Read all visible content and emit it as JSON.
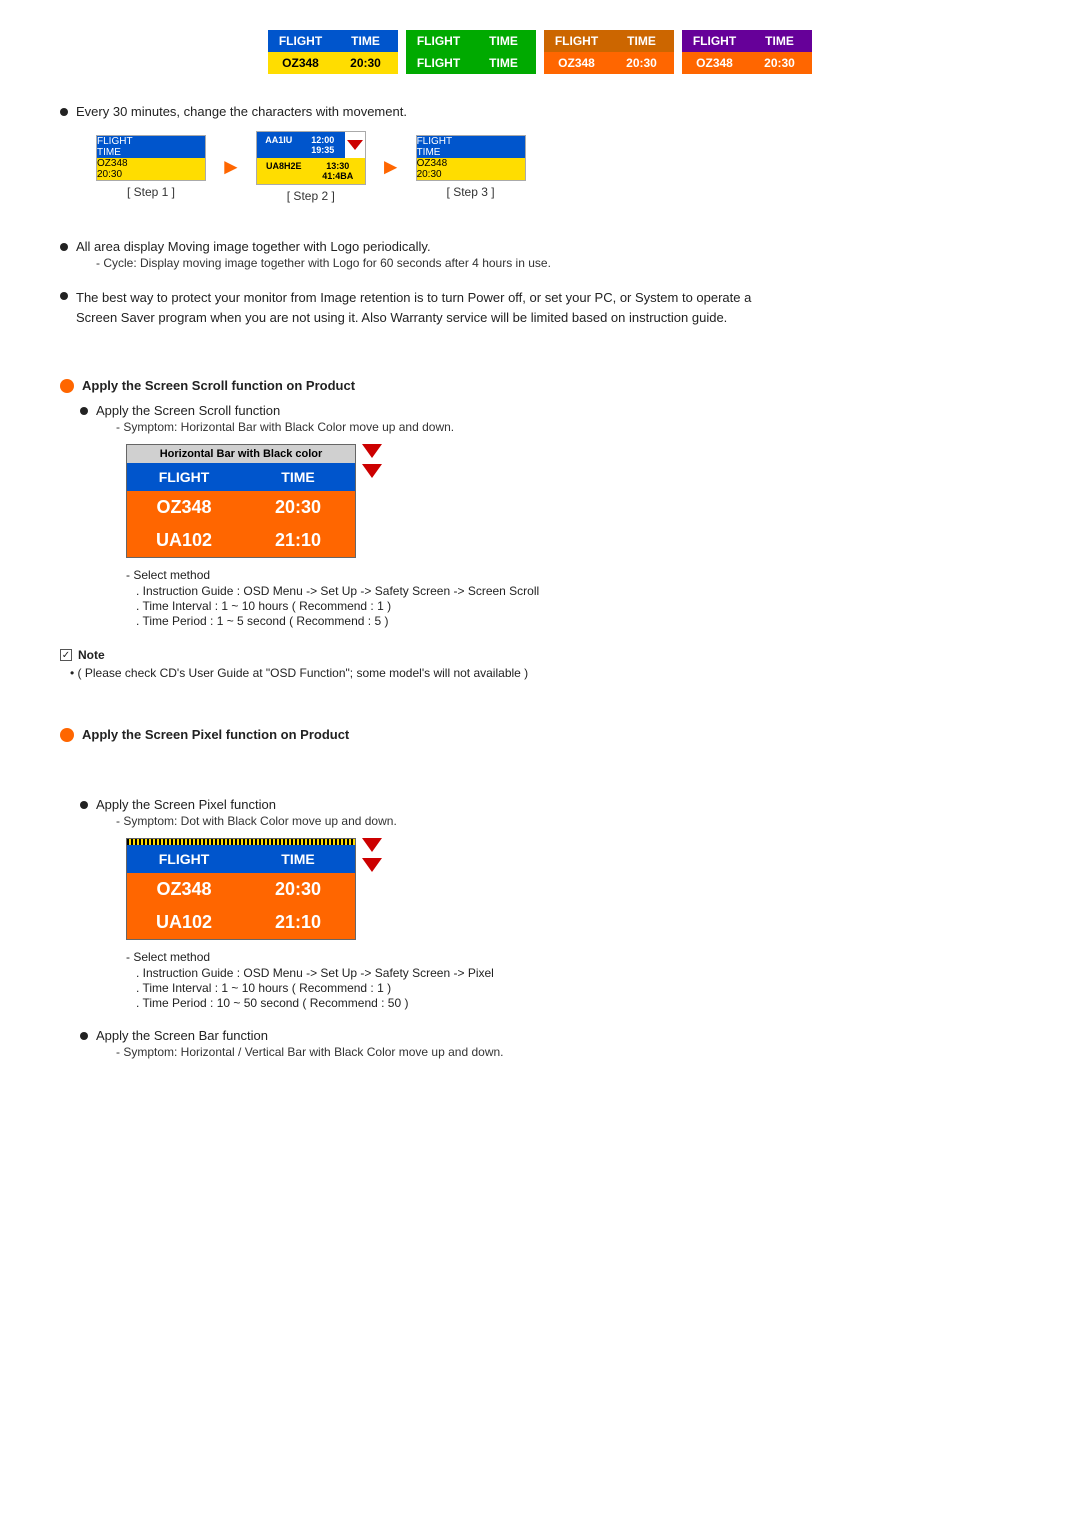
{
  "panels_row1": [
    {
      "top_left": "FLIGHT",
      "top_right": "TIME",
      "bottom_left": "OZ348",
      "bottom_right": "20:30",
      "top_bg": "blue",
      "bottom_bg": "yellow"
    },
    {
      "top_left": "FLIGHT",
      "top_right": "TIME",
      "bottom_left": "FLIGHT",
      "bottom_right": "TIME",
      "top_bg": "green",
      "bottom_bg": "green"
    },
    {
      "top_left": "FLIGHT",
      "top_right": "TIME",
      "bottom_left": "OZ348",
      "bottom_right": "20:30",
      "top_bg": "orange",
      "bottom_bg": "orange"
    },
    {
      "top_left": "FLIGHT",
      "top_right": "TIME",
      "bottom_left": "OZ348",
      "bottom_right": "20:30",
      "top_bg": "purple",
      "bottom_bg": "orange"
    }
  ],
  "bullet1": {
    "text": "Every 30 minutes, change the characters with movement."
  },
  "steps": {
    "step1_label": "[ Step 1 ]",
    "step2_label": "[ Step 2 ]",
    "step3_label": "[ Step 3 ]"
  },
  "bullet2": {
    "text": "All area display Moving image together with Logo periodically.",
    "sub": "- Cycle: Display moving image together with Logo for 60 seconds after 4 hours in use."
  },
  "bullet3": {
    "text": "The best way to protect your monitor from Image retention is to turn Power off, or set your PC, or System to operate a Screen Saver program when you are not using it. Also Warranty service will be limited based on instruction guide."
  },
  "screen_scroll": {
    "header": "Apply the Screen Scroll function on Product",
    "sub1": "Apply the Screen Scroll function",
    "sub1_symptom": "- Symptom: Horizontal Bar with Black Color move up and down.",
    "table_header": "Horizontal Bar with Black color",
    "rows": [
      {
        "left": "FLIGHT",
        "right": "TIME",
        "left_bg": "blue",
        "right_bg": "blue"
      },
      {
        "left": "OZ348",
        "right": "20:30",
        "left_bg": "orange",
        "right_bg": "orange"
      },
      {
        "left": "UA102",
        "right": "21:10",
        "left_bg": "orange",
        "right_bg": "orange"
      }
    ],
    "select_method": "- Select method",
    "lines": [
      ". Instruction Guide : OSD Menu -> Set Up -> Safety Screen -> Screen Scroll",
      ". Time Interval : 1 ~ 10 hours ( Recommend : 1 )",
      ". Time Period : 1 ~ 5 second ( Recommend : 5 )"
    ]
  },
  "note": {
    "header": "Note",
    "bullet": "( Please check CD's User Guide at \"OSD Function\"; some model's will not available )"
  },
  "screen_pixel": {
    "header": "Apply the Screen Pixel function on Product",
    "sub1": "Apply the Screen Pixel function",
    "sub1_symptom": "- Symptom: Dot with Black Color move up and down.",
    "rows": [
      {
        "left": "FLIGHT",
        "right": "TIME",
        "left_bg": "blue",
        "right_bg": "blue"
      },
      {
        "left": "OZ348",
        "right": "20:30",
        "left_bg": "orange",
        "right_bg": "orange"
      },
      {
        "left": "UA102",
        "right": "21:10",
        "left_bg": "orange",
        "right_bg": "orange"
      }
    ],
    "select_method": "- Select method",
    "lines": [
      ". Instruction Guide : OSD Menu -> Set Up -> Safety Screen -> Pixel",
      ". Time Interval : 1 ~ 10 hours ( Recommend : 1 )",
      ". Time Period : 10 ~ 50 second ( Recommend : 50 )"
    ],
    "sub2": "Apply the Screen Bar function",
    "sub2_symptom": "- Symptom: Horizontal / Vertical Bar with Black Color move up and down."
  }
}
